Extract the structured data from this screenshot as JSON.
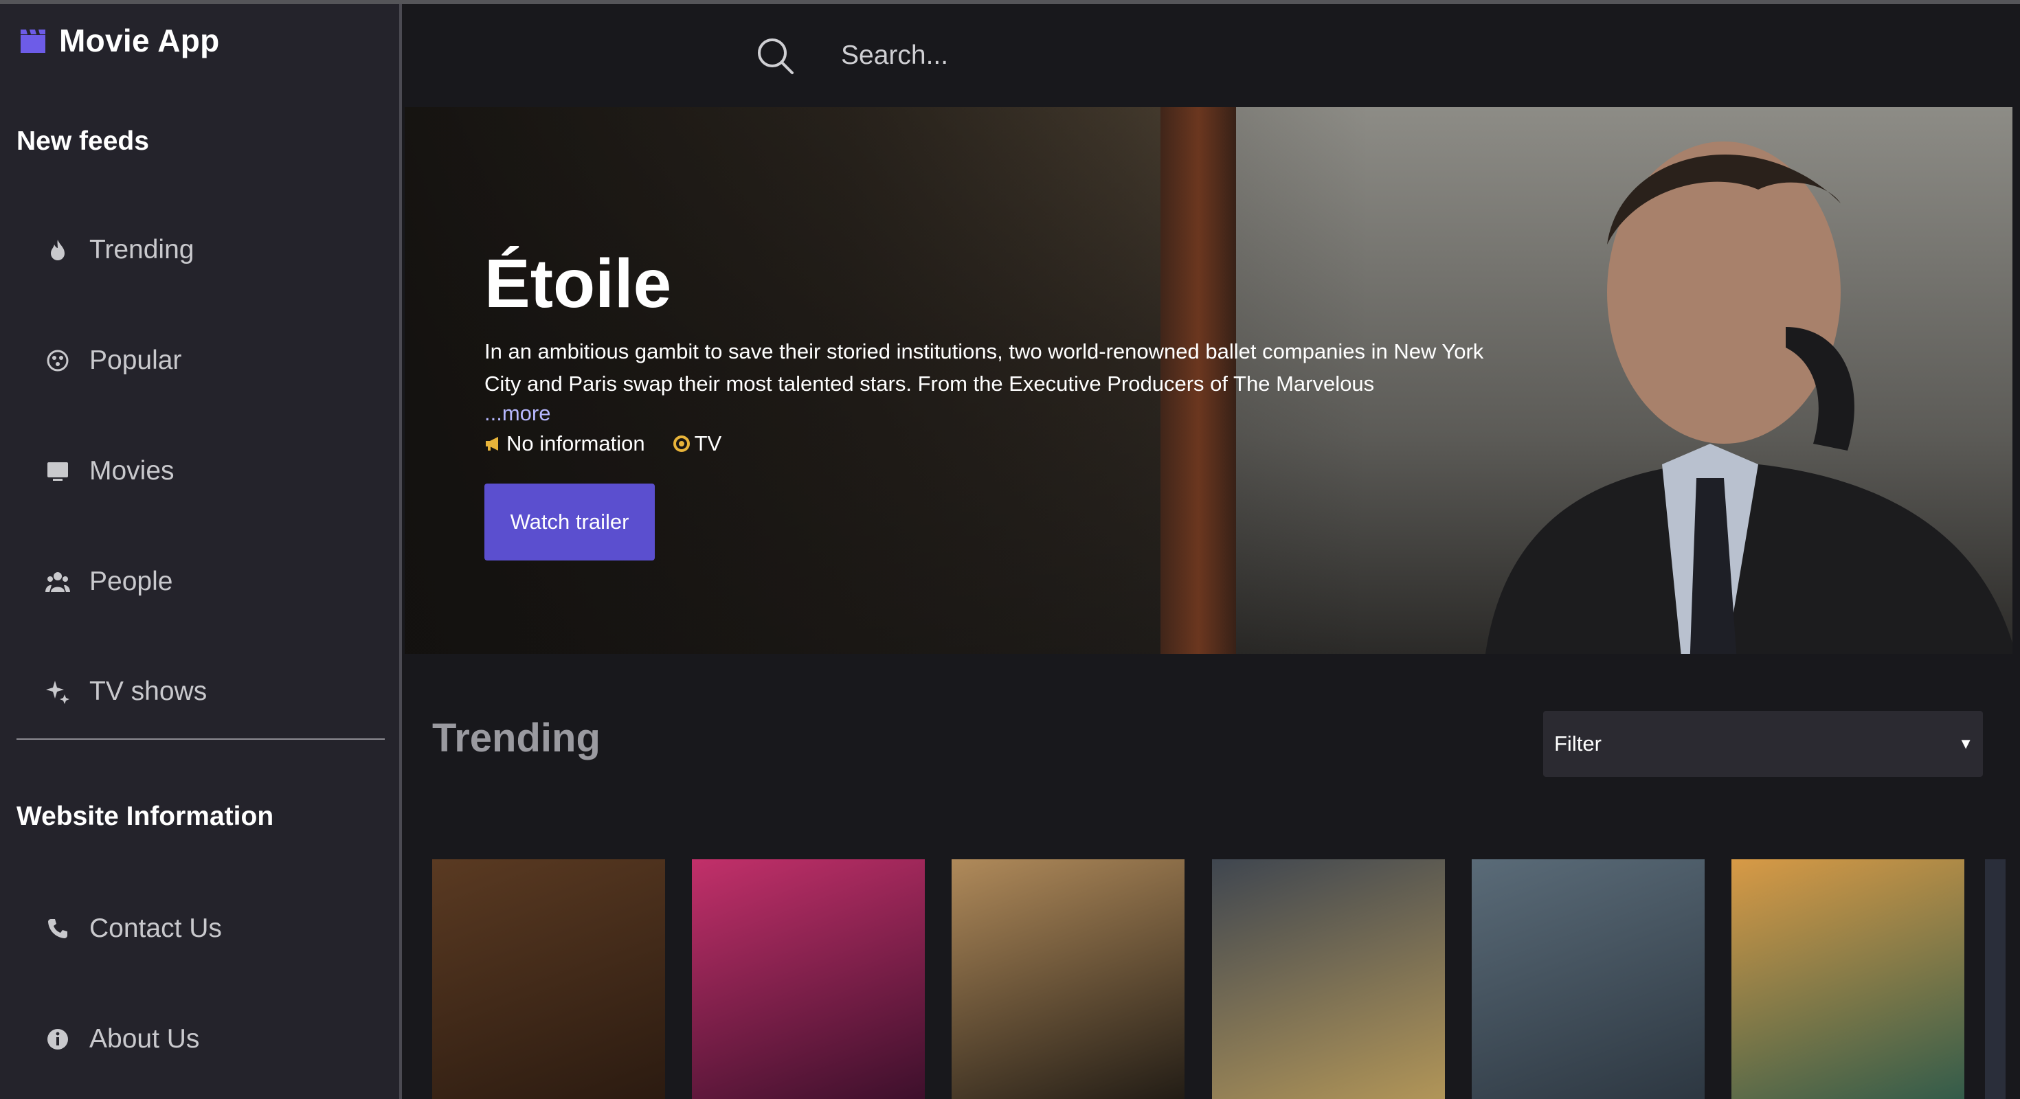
{
  "app": {
    "title": "Movie App"
  },
  "sidebar": {
    "section1_title": "New feeds",
    "nav": [
      {
        "label": "Trending",
        "icon": "flame-icon"
      },
      {
        "label": "Popular",
        "icon": "popular-icon"
      },
      {
        "label": "Movies",
        "icon": "movie-icon"
      },
      {
        "label": "People",
        "icon": "people-icon"
      },
      {
        "label": "TV shows",
        "icon": "sparkle-icon"
      }
    ],
    "section2_title": "Website Information",
    "info": [
      {
        "label": "Contact Us",
        "icon": "phone-icon"
      },
      {
        "label": "About Us",
        "icon": "info-icon"
      }
    ]
  },
  "search": {
    "placeholder": "Search...",
    "value": ""
  },
  "hero": {
    "title": "Étoile",
    "description": "In an ambitious gambit to save their storied institutions, two world-renowned ballet companies in New York City and Paris swap their most talented stars. From the Executive Producers of The Marvelous",
    "more_label": "...more",
    "meta_info": "No information",
    "meta_type": "TV",
    "watch_label": "Watch trailer"
  },
  "trending": {
    "title": "Trending",
    "filter_label": "Filter",
    "posters": [
      {
        "name": "poster-1",
        "colors": [
          "#5a3a22",
          "#2a1a10"
        ]
      },
      {
        "name": "poster-2",
        "colors": [
          "#c2306a",
          "#3a0f2a"
        ]
      },
      {
        "name": "poster-3",
        "colors": [
          "#b08a5a",
          "#1f1a14"
        ]
      },
      {
        "name": "poster-4",
        "colors": [
          "#3f4650",
          "#b49758"
        ]
      },
      {
        "name": "poster-5",
        "colors": [
          "#5a6b78",
          "#2c3640"
        ]
      },
      {
        "name": "poster-6",
        "colors": [
          "#d89a46",
          "#2f5a4a"
        ]
      }
    ]
  },
  "colors": {
    "accent": "#5b4fcf",
    "brand_icon": "#6d5ce8",
    "sidebar_bg": "#24232b",
    "main_bg": "#18181c"
  }
}
